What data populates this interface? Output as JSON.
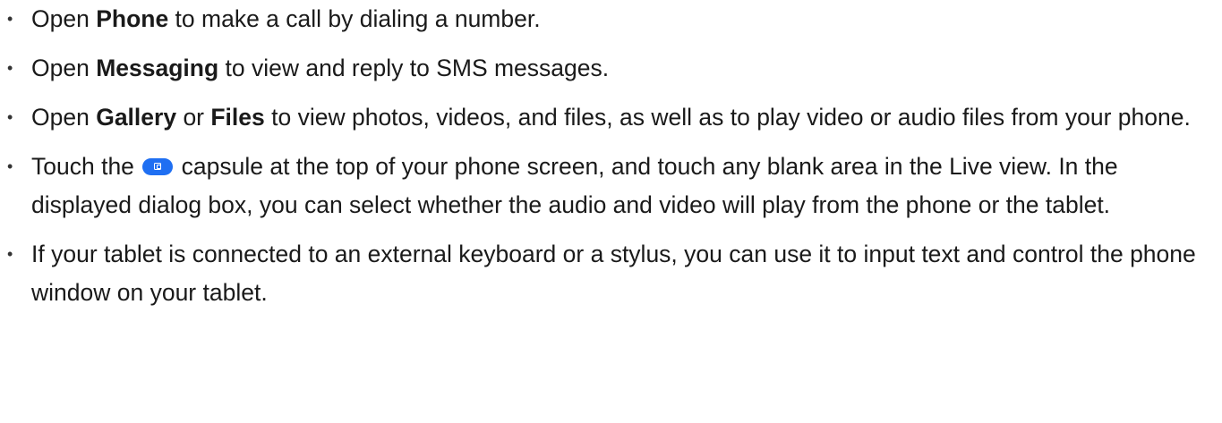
{
  "bullets": [
    {
      "pre": "Open ",
      "bold1": "Phone",
      "post": " to make a call by dialing a number."
    },
    {
      "pre": "Open ",
      "bold1": "Messaging",
      "post": " to view and reply to SMS messages."
    },
    {
      "pre": "Open ",
      "bold1": "Gallery",
      "mid": " or ",
      "bold2": "Files",
      "post": " to view photos, videos, and files, as well as to play video or audio files from your phone."
    },
    {
      "pre": "Touch the ",
      "icon": "capsule-icon",
      "post": " capsule at the top of your phone screen, and touch any blank area in the Live view. In the displayed dialog box, you can select whether the audio and video will play from the phone or the tablet."
    },
    {
      "text": "If your tablet is connected to an external keyboard or a stylus, you can use it to input text and control the phone window on your tablet."
    }
  ],
  "colors": {
    "text": "#1a1a1a",
    "capsule": "#1f6ff2"
  }
}
